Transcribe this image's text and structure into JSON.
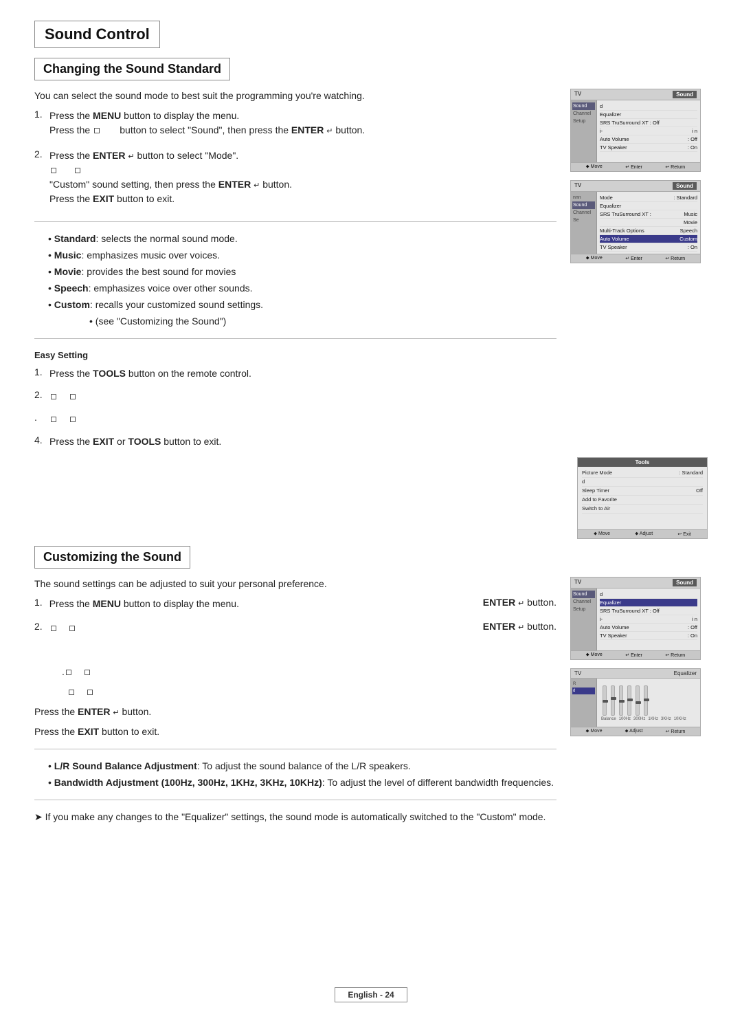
{
  "page": {
    "main_title": "Sound Control",
    "section1": {
      "title": "Changing the Sound Standard",
      "intro": "You can select the sound mode to best suit the programming you're watching.",
      "steps": [
        {
          "num": "1.",
          "text_a": "Press the ",
          "bold_a": "MENU",
          "text_b": " button to display the menu.",
          "text_c": "Press the ",
          "text_d": " button to select \"Sound\", then press the ",
          "bold_b": "ENTER",
          "text_e": " button."
        },
        {
          "num": "2.",
          "text_a": "Press the ",
          "bold_a": "ENTER",
          "text_b": " button to select \"Mode\".",
          "text_c": "\"Custom\" sound setting, then press the ",
          "bold_b": "ENTER",
          "text_d": " button.",
          "text_e": "Press the ",
          "bold_c": "EXIT",
          "text_f": " button to exit."
        }
      ],
      "bullets": [
        {
          "label": "Standard",
          "text": ": selects the normal sound mode."
        },
        {
          "label": "Music",
          "text": ": emphasizes music over voices."
        },
        {
          "label": "Movie",
          "text": ": provides the best sound for movies"
        },
        {
          "label": "Speech",
          "text": ": emphasizes voice over other sounds."
        },
        {
          "label": "Custom",
          "text": ": recalls your customized sound settings."
        },
        {
          "label": "",
          "text": "(see \"Customizing the Sound\")"
        }
      ],
      "easy_setting": {
        "title": "Easy Setting",
        "steps": [
          {
            "num": "1.",
            "text_a": "Press the ",
            "bold_a": "TOOLS",
            "text_b": " button on the remote control."
          },
          {
            "num": "2.",
            "text": ""
          },
          {
            "num": ".",
            "text": ""
          },
          {
            "num": "4.",
            "text_a": "Press the ",
            "bold_a": "EXIT",
            "text_b": " or ",
            "bold_b": "TOOLS",
            "text_c": " button to exit."
          }
        ]
      }
    },
    "section2": {
      "title": "Customizing the Sound",
      "intro": "The sound settings can be adjusted to suit your personal preference.",
      "steps": [
        {
          "num": "1.",
          "text_a": "Press the ",
          "bold_a": "MENU",
          "text_b": " button to display the menu.",
          "right_bold": "ENTER",
          "right_text": " button."
        },
        {
          "num": "2.",
          "right_bold": "ENTER",
          "right_text": " button."
        }
      ],
      "step3_lines": [
        {
          "text": ""
        },
        {
          "text": ""
        }
      ],
      "step_enter": "Press the ",
      "step_enter_bold": "ENTER",
      "step_enter_suffix": " button.",
      "step_exit": "Press the ",
      "step_exit_bold": "EXIT",
      "step_exit_suffix": " button to exit.",
      "bullets": [
        {
          "label": "L/R Sound Balance Adjustment",
          "text": ": To adjust the sound balance of the L/R speakers."
        },
        {
          "label": "Bandwidth Adjustment (100Hz, 300Hz, 1KHz, 3KHz, 10KHz)",
          "text": ": To adjust the level of different bandwidth frequencies."
        }
      ],
      "note": "If you make any changes to the \"Equalizer\" settings, the sound mode is automatically switched to the \"Custom\" mode."
    },
    "footer": {
      "label": "English - 24"
    },
    "screen1": {
      "tv_label": "TV",
      "section_label": "Sound",
      "sidebar_items": [
        "Sound",
        "Channel",
        "Setup"
      ],
      "active_sidebar": "Sound",
      "rows": [
        {
          "label": "d",
          "value": ""
        },
        {
          "label": "Equalizer",
          "value": ""
        },
        {
          "label": "SRS TruSurround XT : Off",
          "value": ""
        },
        {
          "label": "i-",
          "value": "i n"
        },
        {
          "label": "Auto Volume",
          "value": ": Off"
        },
        {
          "label": "TV Speaker",
          "value": ": On"
        }
      ],
      "footer": [
        "⬥ Move",
        "↵ Enter",
        "↩ Return"
      ]
    },
    "screen2": {
      "tv_label": "TV",
      "section_label": "Sound",
      "sidebar_items": [
        "Sound",
        "Channel",
        "Se"
      ],
      "rows": [
        {
          "label": "Mode",
          "value": ": Standard"
        },
        {
          "label": "Equalizer",
          "value": ""
        },
        {
          "label": "SRS TruSurround XT :",
          "value": "Music"
        },
        {
          "label": "",
          "value": "Movie"
        },
        {
          "label": "Multi-Track Options",
          "value": "Speech"
        },
        {
          "label": "Auto Volume",
          "value": "Custom",
          "highlighted": true
        },
        {
          "label": "TV Speaker",
          "value": ": On"
        }
      ],
      "footer": [
        "⬥ Move",
        "↵ Enter",
        "↩ Return"
      ]
    },
    "screen_tools": {
      "title": "Tools",
      "rows": [
        {
          "label": "Picture Mode",
          "value": ": Standard"
        },
        {
          "label": "d",
          "value": ""
        },
        {
          "label": "Sleep Timer",
          "value": "Off"
        },
        {
          "label": "Add to Favorite",
          "value": ""
        },
        {
          "label": "Switch to Air",
          "value": ""
        }
      ],
      "footer": [
        "⬥ Move",
        "⬥ Adjust",
        "↩ Exit"
      ]
    },
    "screen3": {
      "tv_label": "TV",
      "section_label": "Sound",
      "rows": [
        {
          "label": "d",
          "value": ""
        },
        {
          "label": "Equalizer",
          "value": "",
          "highlighted": true
        },
        {
          "label": "SRS TruSurround XT : Off",
          "value": ""
        },
        {
          "label": "i-",
          "value": "i n"
        },
        {
          "label": "Auto Volume",
          "value": ": Off"
        },
        {
          "label": "TV Speaker",
          "value": ": On"
        }
      ],
      "footer": [
        "⬥ Move",
        "↵ Enter",
        "↩ Return"
      ]
    },
    "screen_eq": {
      "tv_label": "TV",
      "section_label": "Equalizer",
      "labels": [
        "Balance",
        "100Hz",
        "300Hz",
        "1KHz",
        "3KHz",
        "10KHz"
      ],
      "footer": [
        "⬥ Move",
        "⬥ Adjust",
        "↩ Return"
      ]
    }
  }
}
